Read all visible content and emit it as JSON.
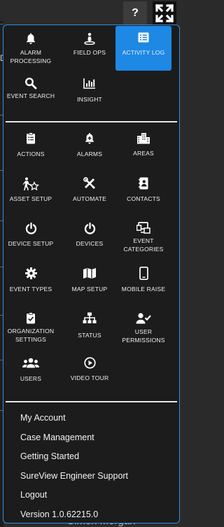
{
  "background": {
    "edge_letter": "D",
    "user_name": "Simon Morgan"
  },
  "topbar": {
    "help_label": "?",
    "fullscreen_icon": "expand-icon"
  },
  "colors": {
    "accent": "#1e88e5",
    "menu_border": "#2f8fe0",
    "menu_bg": "#1c1c1c"
  },
  "main_tiles": [
    {
      "label": "ALARM PROCESSING",
      "icon": "bell-icon",
      "active": false
    },
    {
      "label": "FIELD OPS",
      "icon": "person-pin-icon",
      "active": false
    },
    {
      "label": "ACTIVITY LOG",
      "icon": "list-icon",
      "active": true
    },
    {
      "label": "EVENT SEARCH",
      "icon": "search-icon",
      "active": false
    },
    {
      "label": "INSIGHT",
      "icon": "chart-icon",
      "active": false
    }
  ],
  "admin_tiles": [
    {
      "label": "ACTIONS",
      "icon": "clipboard-icon"
    },
    {
      "label": "ALARMS",
      "icon": "bell-plus-icon"
    },
    {
      "label": "AREAS",
      "icon": "building-icon"
    },
    {
      "label": "ASSET SETUP",
      "icon": "person-star-icon"
    },
    {
      "label": "AUTOMATE",
      "icon": "tools-icon"
    },
    {
      "label": "CONTACTS",
      "icon": "contact-book-icon"
    },
    {
      "label": "DEVICE SETUP",
      "icon": "power-icon"
    },
    {
      "label": "DEVICES",
      "icon": "power-icon"
    },
    {
      "label": "EVENT CATEGORIES",
      "icon": "device-grid-icon"
    },
    {
      "label": "EVENT TYPES",
      "icon": "gear-icon"
    },
    {
      "label": "MAP SETUP",
      "icon": "map-icon"
    },
    {
      "label": "MOBILE RAISE",
      "icon": "phone-icon"
    },
    {
      "label": "ORGANIZATION SETTINGS",
      "icon": "clipboard-check-icon"
    },
    {
      "label": "STATUS",
      "icon": "sitemap-icon"
    },
    {
      "label": "USER PERMISSIONS",
      "icon": "user-check-icon"
    },
    {
      "label": "USERS",
      "icon": "users-icon"
    },
    {
      "label": "VIDEO TOUR",
      "icon": "play-circle-icon"
    }
  ],
  "links": [
    "My Account",
    "Case Management",
    "Getting Started",
    "SureView Engineer Support",
    "Logout"
  ],
  "version": "Version 1.0.62215.0"
}
